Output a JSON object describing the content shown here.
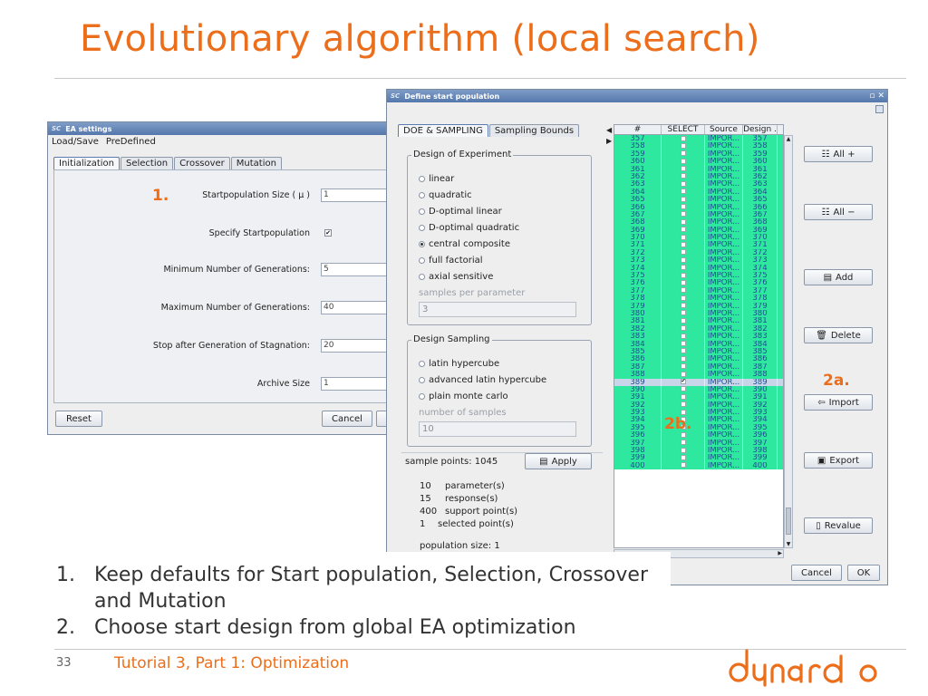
{
  "slide": {
    "title": "Evolutionary algorithm (local search)",
    "bullets": [
      {
        "num": "1.",
        "text": "Keep defaults for Start population, Selection, Crossover and Mutation"
      },
      {
        "num": "2.",
        "text": "Choose start design from global EA optimization"
      }
    ],
    "page_number": "33",
    "footer": "Tutorial 3, Part 1: Optimization",
    "logo_text": "dynardo",
    "callouts": {
      "one": "1.",
      "two_a": "2a.",
      "two_b": "2b."
    },
    "accent_color": "#ec6e1a"
  },
  "ea_window": {
    "app_badge": "SC",
    "title": "EA settings",
    "menu": [
      "Load/Save",
      "PreDefined"
    ],
    "tabs": [
      "Initialization",
      "Selection",
      "Crossover",
      "Mutation"
    ],
    "fields": [
      {
        "label": "Startpopulation Size ( μ )",
        "value": "1"
      },
      {
        "label": "Specify Startpopulation",
        "checked": true
      },
      {
        "label": "Minimum Number of Generations:",
        "value": "5"
      },
      {
        "label": "Maximum Number of Generations:",
        "value": "40"
      },
      {
        "label": "Stop after Generation of Stagnation:",
        "value": "20"
      },
      {
        "label": "Archive Size",
        "value": "1"
      }
    ],
    "reset_label": "Reset",
    "cancel_label": "Cancel"
  },
  "dsp_window": {
    "app_badge": "SC",
    "title": "Define start population",
    "tabs": [
      "DOE & SAMPLING",
      "Sampling Bounds"
    ],
    "doe": {
      "title": "Design of Experiment",
      "options": [
        "linear",
        "quadratic",
        "D-optimal linear",
        "D-optimal quadratic",
        "central composite",
        "full factorial",
        "axial sensitive"
      ],
      "selected": "central composite",
      "samples_label": "samples per parameter",
      "samples_value": "3"
    },
    "sampling": {
      "title": "Design Sampling",
      "options": [
        "latin hypercube",
        "advanced latin hypercube",
        "plain monte carlo"
      ],
      "samples_label": "number of samples",
      "samples_value": "10"
    },
    "sample_points": "sample points: 1045",
    "apply_label": "Apply",
    "info": [
      {
        "count": "10",
        "label": "parameter(s)"
      },
      {
        "count": "15",
        "label": "response(s)"
      },
      {
        "count": "400",
        "label": "support point(s)"
      },
      {
        "count": "1",
        "label": "selected point(s)"
      }
    ],
    "population_size": "population size:  1",
    "table": {
      "columns": [
        "#",
        "SELECT",
        "Source",
        "Design ."
      ],
      "rows": [
        {
          "n": "357",
          "src": "IMPOR...",
          "d": "357"
        },
        {
          "n": "358",
          "src": "IMPOR...",
          "d": "358"
        },
        {
          "n": "359",
          "src": "IMPOR...",
          "d": "359"
        },
        {
          "n": "360",
          "src": "IMPOR...",
          "d": "360"
        },
        {
          "n": "361",
          "src": "IMPOR...",
          "d": "361"
        },
        {
          "n": "362",
          "src": "IMPOR...",
          "d": "362"
        },
        {
          "n": "363",
          "src": "IMPOR...",
          "d": "363"
        },
        {
          "n": "364",
          "src": "IMPOR...",
          "d": "364"
        },
        {
          "n": "365",
          "src": "IMPOR...",
          "d": "365"
        },
        {
          "n": "366",
          "src": "IMPOR...",
          "d": "366"
        },
        {
          "n": "367",
          "src": "IMPOR...",
          "d": "367"
        },
        {
          "n": "368",
          "src": "IMPOR...",
          "d": "368"
        },
        {
          "n": "369",
          "src": "IMPOR...",
          "d": "369"
        },
        {
          "n": "370",
          "src": "IMPOR...",
          "d": "370"
        },
        {
          "n": "371",
          "src": "IMPOR...",
          "d": "371"
        },
        {
          "n": "372",
          "src": "IMPOR...",
          "d": "372"
        },
        {
          "n": "373",
          "src": "IMPOR...",
          "d": "373"
        },
        {
          "n": "374",
          "src": "IMPOR...",
          "d": "374"
        },
        {
          "n": "375",
          "src": "IMPOR...",
          "d": "375"
        },
        {
          "n": "376",
          "src": "IMPOR...",
          "d": "376"
        },
        {
          "n": "377",
          "src": "IMPOR...",
          "d": "377"
        },
        {
          "n": "378",
          "src": "IMPOR...",
          "d": "378"
        },
        {
          "n": "379",
          "src": "IMPOR...",
          "d": "379"
        },
        {
          "n": "380",
          "src": "IMPOR...",
          "d": "380"
        },
        {
          "n": "381",
          "src": "IMPOR...",
          "d": "381"
        },
        {
          "n": "382",
          "src": "IMPOR...",
          "d": "382"
        },
        {
          "n": "383",
          "src": "IMPOR...",
          "d": "383"
        },
        {
          "n": "384",
          "src": "IMPOR...",
          "d": "384"
        },
        {
          "n": "385",
          "src": "IMPOR...",
          "d": "385"
        },
        {
          "n": "386",
          "src": "IMPOR...",
          "d": "386"
        },
        {
          "n": "387",
          "src": "IMPOR...",
          "d": "387"
        },
        {
          "n": "388",
          "src": "IMPOR...",
          "d": "388"
        },
        {
          "n": "389",
          "src": "IMPOR...",
          "d": "389",
          "selected": true
        },
        {
          "n": "390",
          "src": "IMPOR...",
          "d": "390"
        },
        {
          "n": "391",
          "src": "IMPOR...",
          "d": "391"
        },
        {
          "n": "392",
          "src": "IMPOR...",
          "d": "392"
        },
        {
          "n": "393",
          "src": "IMPOR...",
          "d": "393"
        },
        {
          "n": "394",
          "src": "IMPOR...",
          "d": "394"
        },
        {
          "n": "395",
          "src": "IMPOR...",
          "d": "395"
        },
        {
          "n": "396",
          "src": "IMPOR...",
          "d": "396"
        },
        {
          "n": "397",
          "src": "IMPOR...",
          "d": "397"
        },
        {
          "n": "398",
          "src": "IMPOR...",
          "d": "398"
        },
        {
          "n": "399",
          "src": "IMPOR...",
          "d": "399"
        },
        {
          "n": "400",
          "src": "IMPOR...",
          "d": "400"
        }
      ]
    },
    "side_buttons": [
      {
        "icon": "select-all-icon",
        "label": "All +"
      },
      {
        "icon": "deselect-all-icon",
        "label": "All −"
      },
      {
        "icon": "add-icon",
        "label": "Add"
      },
      {
        "icon": "trash-icon",
        "label": "Delete"
      },
      {
        "icon": "import-icon",
        "label": "Import"
      },
      {
        "icon": "export-icon",
        "label": "Export"
      },
      {
        "icon": "revalue-icon",
        "label": "Revalue"
      }
    ],
    "cancel_label": "Cancel",
    "ok_label": "OK",
    "row_color": "#2ee8a0",
    "selected_row_color": "#c9d6ea"
  }
}
